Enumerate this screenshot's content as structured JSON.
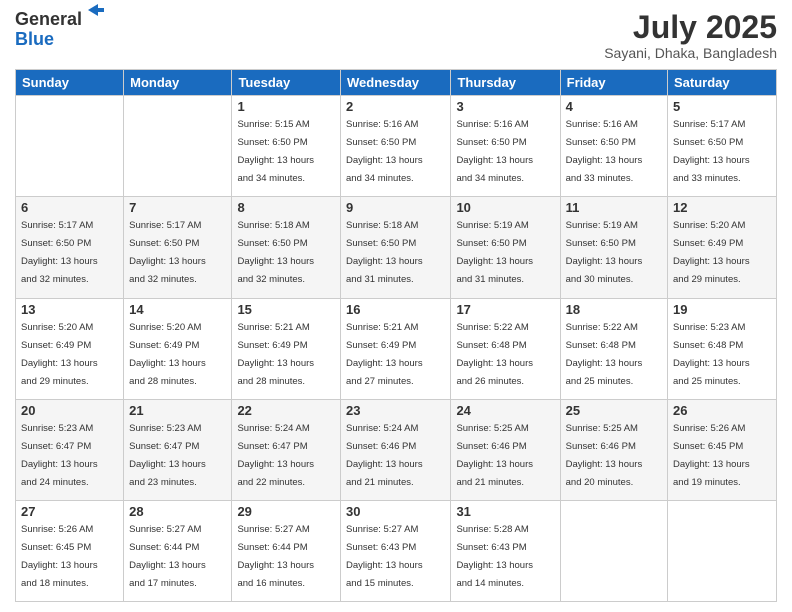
{
  "logo": {
    "general": "General",
    "blue": "Blue"
  },
  "title": {
    "month_year": "July 2025",
    "location": "Sayani, Dhaka, Bangladesh"
  },
  "headers": [
    "Sunday",
    "Monday",
    "Tuesday",
    "Wednesday",
    "Thursday",
    "Friday",
    "Saturday"
  ],
  "weeks": [
    [
      {
        "day": "",
        "info": ""
      },
      {
        "day": "",
        "info": ""
      },
      {
        "day": "1",
        "info": "Sunrise: 5:15 AM\nSunset: 6:50 PM\nDaylight: 13 hours\nand 34 minutes."
      },
      {
        "day": "2",
        "info": "Sunrise: 5:16 AM\nSunset: 6:50 PM\nDaylight: 13 hours\nand 34 minutes."
      },
      {
        "day": "3",
        "info": "Sunrise: 5:16 AM\nSunset: 6:50 PM\nDaylight: 13 hours\nand 34 minutes."
      },
      {
        "day": "4",
        "info": "Sunrise: 5:16 AM\nSunset: 6:50 PM\nDaylight: 13 hours\nand 33 minutes."
      },
      {
        "day": "5",
        "info": "Sunrise: 5:17 AM\nSunset: 6:50 PM\nDaylight: 13 hours\nand 33 minutes."
      }
    ],
    [
      {
        "day": "6",
        "info": "Sunrise: 5:17 AM\nSunset: 6:50 PM\nDaylight: 13 hours\nand 32 minutes."
      },
      {
        "day": "7",
        "info": "Sunrise: 5:17 AM\nSunset: 6:50 PM\nDaylight: 13 hours\nand 32 minutes."
      },
      {
        "day": "8",
        "info": "Sunrise: 5:18 AM\nSunset: 6:50 PM\nDaylight: 13 hours\nand 32 minutes."
      },
      {
        "day": "9",
        "info": "Sunrise: 5:18 AM\nSunset: 6:50 PM\nDaylight: 13 hours\nand 31 minutes."
      },
      {
        "day": "10",
        "info": "Sunrise: 5:19 AM\nSunset: 6:50 PM\nDaylight: 13 hours\nand 31 minutes."
      },
      {
        "day": "11",
        "info": "Sunrise: 5:19 AM\nSunset: 6:50 PM\nDaylight: 13 hours\nand 30 minutes."
      },
      {
        "day": "12",
        "info": "Sunrise: 5:20 AM\nSunset: 6:49 PM\nDaylight: 13 hours\nand 29 minutes."
      }
    ],
    [
      {
        "day": "13",
        "info": "Sunrise: 5:20 AM\nSunset: 6:49 PM\nDaylight: 13 hours\nand 29 minutes."
      },
      {
        "day": "14",
        "info": "Sunrise: 5:20 AM\nSunset: 6:49 PM\nDaylight: 13 hours\nand 28 minutes."
      },
      {
        "day": "15",
        "info": "Sunrise: 5:21 AM\nSunset: 6:49 PM\nDaylight: 13 hours\nand 28 minutes."
      },
      {
        "day": "16",
        "info": "Sunrise: 5:21 AM\nSunset: 6:49 PM\nDaylight: 13 hours\nand 27 minutes."
      },
      {
        "day": "17",
        "info": "Sunrise: 5:22 AM\nSunset: 6:48 PM\nDaylight: 13 hours\nand 26 minutes."
      },
      {
        "day": "18",
        "info": "Sunrise: 5:22 AM\nSunset: 6:48 PM\nDaylight: 13 hours\nand 25 minutes."
      },
      {
        "day": "19",
        "info": "Sunrise: 5:23 AM\nSunset: 6:48 PM\nDaylight: 13 hours\nand 25 minutes."
      }
    ],
    [
      {
        "day": "20",
        "info": "Sunrise: 5:23 AM\nSunset: 6:47 PM\nDaylight: 13 hours\nand 24 minutes."
      },
      {
        "day": "21",
        "info": "Sunrise: 5:23 AM\nSunset: 6:47 PM\nDaylight: 13 hours\nand 23 minutes."
      },
      {
        "day": "22",
        "info": "Sunrise: 5:24 AM\nSunset: 6:47 PM\nDaylight: 13 hours\nand 22 minutes."
      },
      {
        "day": "23",
        "info": "Sunrise: 5:24 AM\nSunset: 6:46 PM\nDaylight: 13 hours\nand 21 minutes."
      },
      {
        "day": "24",
        "info": "Sunrise: 5:25 AM\nSunset: 6:46 PM\nDaylight: 13 hours\nand 21 minutes."
      },
      {
        "day": "25",
        "info": "Sunrise: 5:25 AM\nSunset: 6:46 PM\nDaylight: 13 hours\nand 20 minutes."
      },
      {
        "day": "26",
        "info": "Sunrise: 5:26 AM\nSunset: 6:45 PM\nDaylight: 13 hours\nand 19 minutes."
      }
    ],
    [
      {
        "day": "27",
        "info": "Sunrise: 5:26 AM\nSunset: 6:45 PM\nDaylight: 13 hours\nand 18 minutes."
      },
      {
        "day": "28",
        "info": "Sunrise: 5:27 AM\nSunset: 6:44 PM\nDaylight: 13 hours\nand 17 minutes."
      },
      {
        "day": "29",
        "info": "Sunrise: 5:27 AM\nSunset: 6:44 PM\nDaylight: 13 hours\nand 16 minutes."
      },
      {
        "day": "30",
        "info": "Sunrise: 5:27 AM\nSunset: 6:43 PM\nDaylight: 13 hours\nand 15 minutes."
      },
      {
        "day": "31",
        "info": "Sunrise: 5:28 AM\nSunset: 6:43 PM\nDaylight: 13 hours\nand 14 minutes."
      },
      {
        "day": "",
        "info": ""
      },
      {
        "day": "",
        "info": ""
      }
    ]
  ]
}
